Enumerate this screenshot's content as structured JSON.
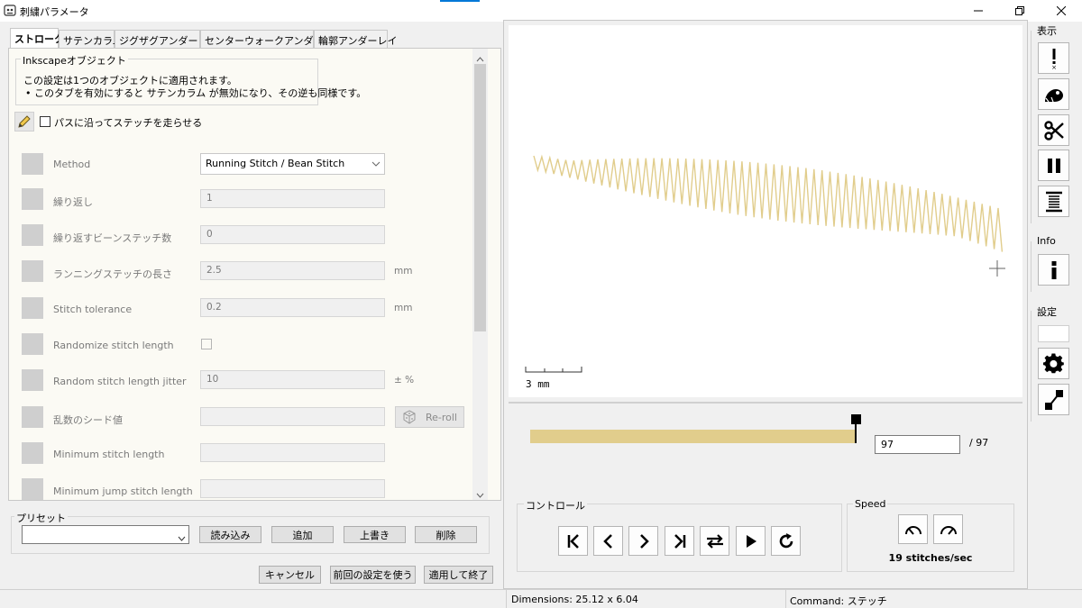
{
  "window": {
    "title": "刺繍パラメータ"
  },
  "tabs": [
    {
      "label": "ストローク"
    },
    {
      "label": "サテンカラム"
    },
    {
      "label": "ジグザグアンダーレイ"
    },
    {
      "label": "センターウォークアンダーレイ"
    },
    {
      "label": "輪郭アンダーレイ"
    }
  ],
  "info_box": {
    "title": "Inkscapeオブジェクト",
    "line1": "この設定は1つのオブジェクトに適用されます。",
    "line2": "• このタブを有効にすると サテンカラム が無効になり、その逆も同様です。"
  },
  "enable_checkbox": {
    "label": "パスに沿ってステッチを走らせる",
    "checked": false
  },
  "params": [
    {
      "label": "Method",
      "value": "Running Stitch / Bean Stitch",
      "unit": ""
    },
    {
      "label": "繰り返し",
      "value": "1",
      "unit": ""
    },
    {
      "label": "繰り返すビーンステッチ数",
      "value": "0",
      "unit": ""
    },
    {
      "label": "ランニングステッチの長さ",
      "value": "2.5",
      "unit": "mm"
    },
    {
      "label": "Stitch tolerance",
      "value": "0.2",
      "unit": "mm"
    },
    {
      "label": "Randomize stitch length",
      "value": "",
      "unit": ""
    },
    {
      "label": "Random stitch length jitter",
      "value": "10",
      "unit": "± %"
    },
    {
      "label": "乱数のシード値",
      "value": "",
      "unit": ""
    },
    {
      "label": "Minimum stitch length",
      "value": "",
      "unit": ""
    },
    {
      "label": "Minimum jump stitch length",
      "value": "",
      "unit": ""
    }
  ],
  "reroll_label": "Re-roll",
  "presets": {
    "title": "プリセット",
    "selected": "",
    "load": "読み込み",
    "add": "追加",
    "overwrite": "上書き",
    "delete": "削除"
  },
  "bottom_buttons": {
    "cancel": "キャンセル",
    "use_last": "前回の設定を使う",
    "apply_close": "適用して終了"
  },
  "preview": {
    "scale_label": "3 mm",
    "stitch_color": "#e1cd8c",
    "slider_value": "97",
    "slider_total": "/ 97",
    "progress_fraction": 1.0
  },
  "controls": {
    "title": "コントロール"
  },
  "speed": {
    "title": "Speed",
    "value_label": "19 stitches/sec"
  },
  "side_toolbar": {
    "display_label": "表示",
    "info_label": "Info",
    "settings_label": "設定"
  },
  "status": {
    "dimensions": "Dimensions: 25.12 x 6.04",
    "command": "Command: ステッチ"
  }
}
